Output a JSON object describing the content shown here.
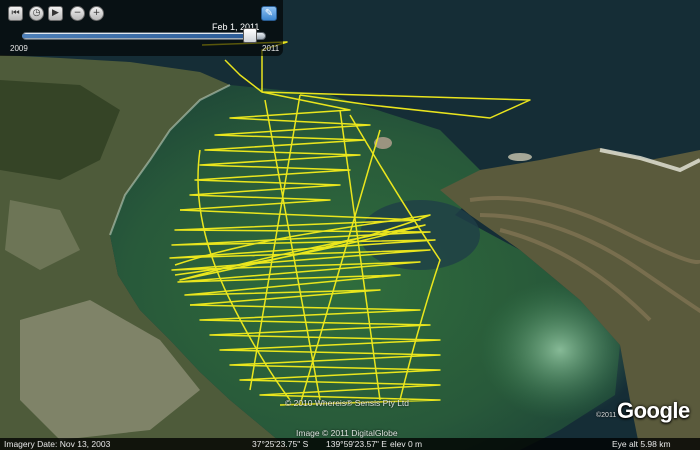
{
  "timeline": {
    "current_date": "Feb 1, 2011",
    "start_year": "2009",
    "end_year": "2011",
    "position_fraction": 0.96,
    "buttons": [
      {
        "name": "timeline-rewind-button",
        "icon": "skip-back-icon",
        "glyph": "⏮"
      },
      {
        "name": "timeline-settings-button",
        "icon": "clock-icon",
        "glyph": "◷"
      },
      {
        "name": "timeline-play-button",
        "icon": "play-icon",
        "glyph": "▶"
      },
      {
        "name": "zoom-out-time-button",
        "icon": "zoom-out-icon",
        "glyph": "−"
      },
      {
        "name": "zoom-in-time-button",
        "icon": "zoom-in-icon",
        "glyph": "+"
      }
    ],
    "tools_icon": "wrench-icon"
  },
  "attribution": {
    "center": "© 2010 Whereis® Sensis Pty Ltd",
    "image_credit": "Image © 2011 DigitalGlobe",
    "logo_copyright": "©2011",
    "logo": "Google"
  },
  "statusbar": {
    "imagery_date": "Imagery Date: Nov 13, 2003",
    "latitude": "37°25'23.75\" S",
    "longitude": "139°59'23.57\" E",
    "elevation": "elev    0 m",
    "eye_alt": "Eye alt    5.98 km"
  },
  "colors": {
    "track": "#f5ee1c",
    "water": "#2f6b3a",
    "deep_water": "#1c3a45",
    "shallow": "#8cc9a0"
  }
}
